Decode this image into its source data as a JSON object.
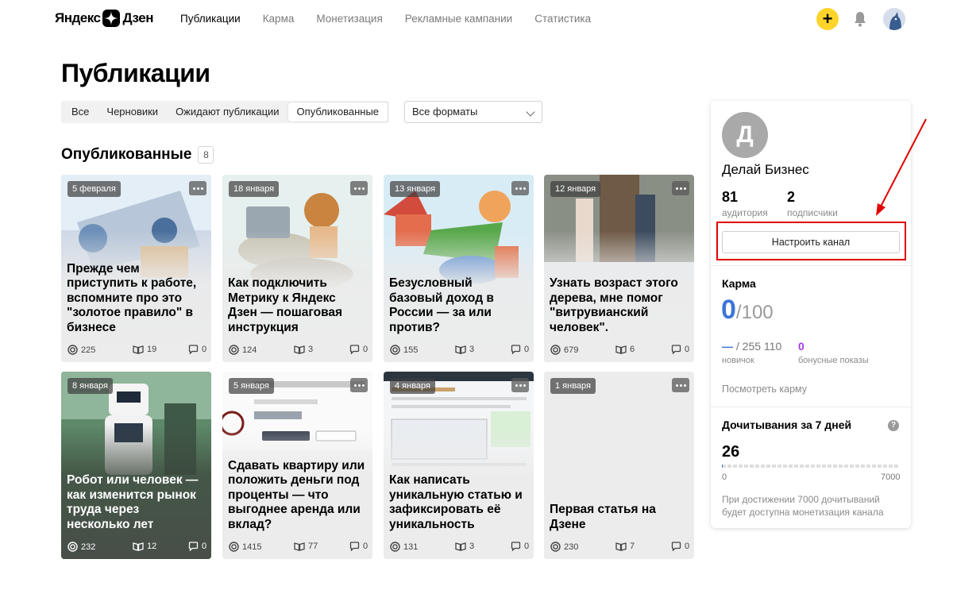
{
  "header": {
    "logo_text_left": "Яндекс",
    "logo_text_right": "Дзен",
    "nav": [
      {
        "label": "Публикации"
      },
      {
        "label": "Карма"
      },
      {
        "label": "Монетизация"
      },
      {
        "label": "Рекламные кампании"
      },
      {
        "label": "Статистика"
      }
    ],
    "plus_label": "+"
  },
  "page": {
    "title": "Публикации"
  },
  "filters": {
    "tabs": [
      {
        "label": "Все"
      },
      {
        "label": "Черновики"
      },
      {
        "label": "Ожидают публикации"
      },
      {
        "label": "Опубликованные"
      }
    ],
    "format_select": "Все форматы"
  },
  "section": {
    "title": "Опубликованные",
    "count": "8"
  },
  "cards": [
    {
      "date": "5 февраля",
      "title": "Прежде чем приступить к работе, вспомните про это \"золотое правило\" в бизнесе",
      "views": "225",
      "reads": "19",
      "comments": "0"
    },
    {
      "date": "18 января",
      "title": "Как подключить Метрику к Яндекс Дзен — пошаговая инструкция",
      "views": "124",
      "reads": "3",
      "comments": "0"
    },
    {
      "date": "13 января",
      "title": "Безусловный базовый доход в России — за или против?",
      "views": "155",
      "reads": "3",
      "comments": "0"
    },
    {
      "date": "12 января",
      "title": "Узнать возраст этого дерева, мне помог \"витрувианский человек\".",
      "views": "679",
      "reads": "6",
      "comments": "0"
    },
    {
      "date": "8 января",
      "title": "Робот или человек — как изменится рынок труда через несколько лет",
      "views": "232",
      "reads": "12",
      "comments": "0"
    },
    {
      "date": "5 января",
      "title": "Сдавать квартиру или положить деньги под проценты — что выгоднее аренда или вклад?",
      "views": "1415",
      "reads": "77",
      "comments": "0"
    },
    {
      "date": "4 января",
      "title": "Как написать уникальную статью и зафиксировать её уникальность",
      "views": "131",
      "reads": "3",
      "comments": "0"
    },
    {
      "date": "1 января",
      "title": "Первая статья на Дзене",
      "views": "230",
      "reads": "7",
      "comments": "0"
    }
  ],
  "sidebar": {
    "avatar_letter": "Д",
    "channel_name": "Делай Бизнес",
    "audience_value": "81",
    "audience_label": "аудитория",
    "subscribers_value": "2",
    "subscribers_label": "подписчики",
    "setup_button": "Настроить канал",
    "karma_title": "Карма",
    "karma_value": "0",
    "karma_max": "/100",
    "rank_dash": "—",
    "rank_value": " / 255 110",
    "rank_label": "новичок",
    "bonus_value": "0",
    "bonus_label": "бонусные показы",
    "karma_link": "Посмотреть карму",
    "reads_title": "Дочитывания за 7 дней",
    "help": "?",
    "reads_value": "26",
    "reads_progress": 0.0037,
    "reads_min": "0",
    "reads_max": "7000",
    "reads_note": "При достижении 7000 дочитываний будет доступна монетизация канала"
  },
  "colors": {
    "accent_yellow": "#fed42b",
    "karma_blue": "#3d76d9",
    "bonus_purple": "#a33bd9",
    "highlight_red": "#e10000"
  }
}
